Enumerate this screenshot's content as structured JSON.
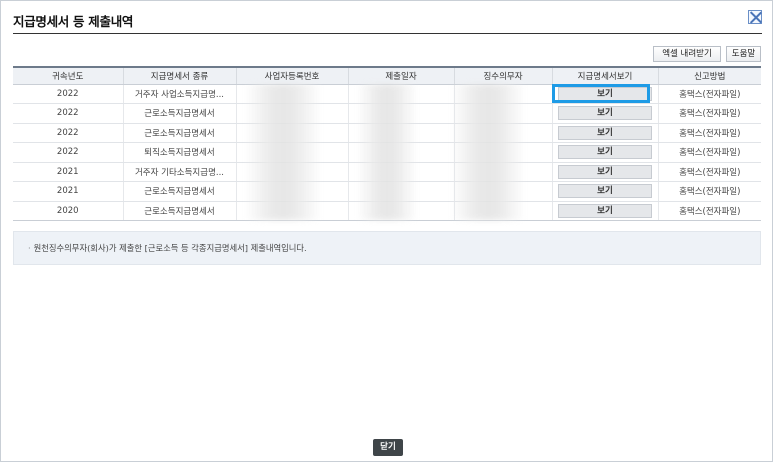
{
  "window": {
    "title": "지급명세서 등 제출내역"
  },
  "toolbar": {
    "excel_label": "엑셀 내려받기",
    "help_label": "도움말"
  },
  "table": {
    "headers": [
      "귀속년도",
      "지급명세서 종류",
      "사업자등록번호",
      "제출일자",
      "징수의무자",
      "지급명세서보기",
      "신고방법"
    ],
    "rows": [
      {
        "year": "2022",
        "kind": "거주자 사업소득지급명...",
        "view": "보기",
        "method": "홈택스(전자파일)"
      },
      {
        "year": "2022",
        "kind": "근로소득지급명세서",
        "view": "보기",
        "method": "홈택스(전자파일)"
      },
      {
        "year": "2022",
        "kind": "근로소득지급명세서",
        "view": "보기",
        "method": "홈택스(전자파일)"
      },
      {
        "year": "2022",
        "kind": "퇴직소득지급명세서",
        "view": "보기",
        "method": "홈택스(전자파일)"
      },
      {
        "year": "2021",
        "kind": "거주자 기타소득지급명...",
        "view": "보기",
        "method": "홈택스(전자파일)"
      },
      {
        "year": "2021",
        "kind": "근로소득지급명세서",
        "view": "보기",
        "method": "홈택스(전자파일)"
      },
      {
        "year": "2020",
        "kind": "근로소득지급명세서",
        "view": "보기",
        "method": "홈택스(전자파일)"
      }
    ]
  },
  "notice": {
    "text": "원천징수의무자(회사)가 제출한 [근로소득 등 각종지급명세서] 제출내역입니다."
  },
  "footer": {
    "close_label": "닫기"
  },
  "colors": {
    "highlight": "#1e9be6",
    "header_bg": "#eef1f5",
    "close_btn": "#3f4549"
  }
}
